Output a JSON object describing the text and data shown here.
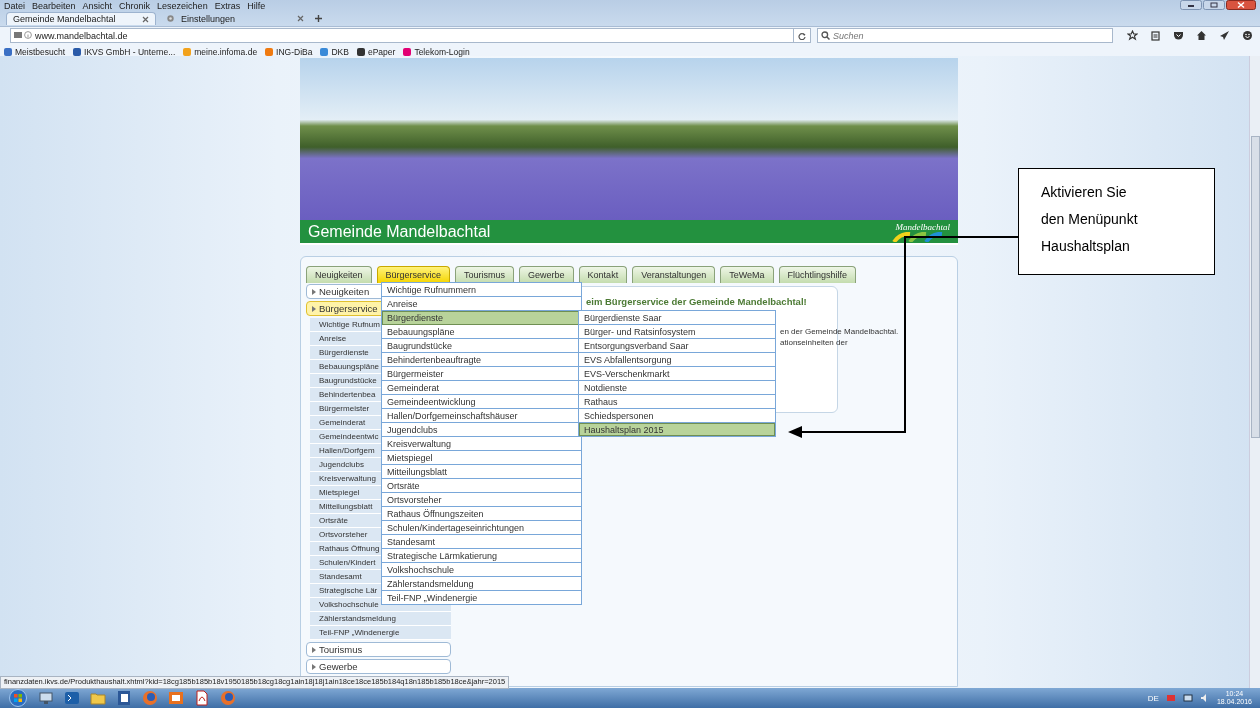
{
  "browser": {
    "menu": [
      "Datei",
      "Bearbeiten",
      "Ansicht",
      "Chronik",
      "Lesezeichen",
      "Extras",
      "Hilfe"
    ],
    "tabs": [
      {
        "label": "Gemeinde Mandelbachtal",
        "selected": true
      },
      {
        "label": "Einstellungen",
        "selected": false
      }
    ],
    "url": "www.mandelbachtal.de",
    "search": {
      "placeholder": "Suchen"
    },
    "bookmarks": [
      "Meistbesucht",
      "IKVS GmbH - Unterne...",
      "meine.infoma.de",
      "ING-DiBa",
      "DKB",
      "ePaper",
      "Telekom-Login"
    ]
  },
  "site": {
    "banner_title": "Gemeinde Mandelbachtal",
    "logo_text": "Mandelbachtal",
    "tabs": [
      {
        "label": "Neuigkeiten",
        "selected": false
      },
      {
        "label": "Bürgerservice",
        "selected": true
      },
      {
        "label": "Tourismus",
        "selected": false
      },
      {
        "label": "Gewerbe",
        "selected": false
      },
      {
        "label": "Kontakt",
        "selected": false
      },
      {
        "label": "Veranstaltungen",
        "selected": false
      },
      {
        "label": "TeWeMa",
        "selected": false
      },
      {
        "label": "Flüchtlingshilfe",
        "selected": false
      }
    ],
    "sidebar": {
      "items": [
        {
          "label": "Neuigkeiten",
          "selected": false
        },
        {
          "label": "Bürgerservice",
          "selected": true,
          "children": [
            "Wichtige Rufnum",
            "Anreise",
            "Bürgerdienste",
            "Bebauungspläne",
            "Baugrundstücke",
            "Behindertenbea",
            "Bürgermeister",
            "Gemeinderat",
            "Gemeindeentwic",
            "Hallen/Dorfgem",
            "Jugendclubs",
            "Kreisverwaltung",
            "Mietspiegel",
            "Mitteilungsblatt",
            "Ortsräte",
            "Ortsvorsteher",
            "Rathaus Öffnung",
            "Schulen/Kindert",
            "Standesamt",
            "Strategische Lär",
            "Volkshochschule",
            "Zählerstandsmeldung",
            "Teil-FNP „Windenergie"
          ]
        },
        {
          "label": "Tourismus",
          "selected": false
        },
        {
          "label": "Gewerbe",
          "selected": false
        }
      ]
    },
    "content": {
      "heading": "eim Bürgerservice der Gemeinde Mandelbachtal!",
      "lines": [
        "en der Gemeinde Mandelbachtal.",
        "ationseinheiten der"
      ]
    },
    "menu": {
      "items": [
        {
          "label": "Wichtige Rufnummern",
          "selected": false
        },
        {
          "label": "Anreise",
          "selected": false
        },
        {
          "label": "Bürgerdienste",
          "selected": true
        },
        {
          "label": "Bebauungspläne",
          "selected": false
        },
        {
          "label": "Baugrundstücke",
          "selected": false
        },
        {
          "label": "Behindertenbeauftragte",
          "selected": false
        },
        {
          "label": "Bürgermeister",
          "selected": false
        },
        {
          "label": "Gemeinderat",
          "selected": false
        },
        {
          "label": "Gemeindeentwicklung",
          "selected": false
        },
        {
          "label": "Hallen/Dorfgemeinschaftshäuser",
          "selected": false
        },
        {
          "label": "Jugendclubs",
          "selected": false
        },
        {
          "label": "Kreisverwaltung",
          "selected": false
        },
        {
          "label": "Mietspiegel",
          "selected": false
        },
        {
          "label": "Mitteilungsblatt",
          "selected": false
        },
        {
          "label": "Ortsräte",
          "selected": false
        },
        {
          "label": "Ortsvorsteher",
          "selected": false
        },
        {
          "label": "Rathaus Öffnungszeiten",
          "selected": false
        },
        {
          "label": "Schulen/Kindertageseinrichtungen",
          "selected": false
        },
        {
          "label": "Standesamt",
          "selected": false
        },
        {
          "label": "Strategische Lärmkatierung",
          "selected": false
        },
        {
          "label": "Volkshochschule",
          "selected": false
        },
        {
          "label": "Zählerstandsmeldung",
          "selected": false
        },
        {
          "label": "Teil-FNP „Windenergie",
          "selected": false
        }
      ],
      "submenu": [
        {
          "label": "Bürgerdienste Saar",
          "selected": false
        },
        {
          "label": "Bürger- und Ratsinfosystem",
          "selected": false
        },
        {
          "label": "Entsorgungsverband Saar",
          "selected": false
        },
        {
          "label": "EVS Abfallentsorgung",
          "selected": false
        },
        {
          "label": "EVS-Verschenkmarkt",
          "selected": false
        },
        {
          "label": "Notdienste",
          "selected": false
        },
        {
          "label": "Rathaus",
          "selected": false
        },
        {
          "label": "Schiedspersonen",
          "selected": false
        },
        {
          "label": "Haushaltsplan 2015",
          "selected": true
        }
      ]
    }
  },
  "callout": {
    "lines": [
      "Aktivieren Sie",
      "den Menüpunkt",
      "Haushaltsplan"
    ]
  },
  "status_link": "finanzdaten.ikvs.de/Produkthaushalt.xhtml?kid=18cg185b185b18v1950185b18cg18cg1ain18j18j1ain18ce18ce185b184q18n185b185b18ce&jahr=2015",
  "taskbar": {
    "language": "DE",
    "time": "10:24",
    "date": "18.04.2016"
  }
}
